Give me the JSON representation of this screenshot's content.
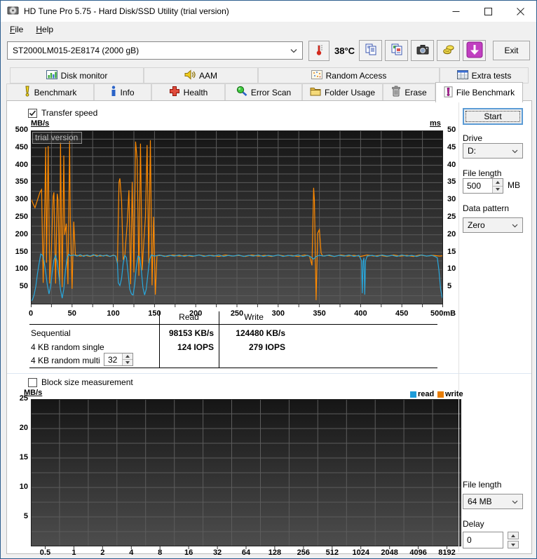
{
  "colors": {
    "read": "#29a8dd",
    "write": "#ff8a00",
    "legend_read": "#1d9cd9",
    "legend_write": "#e87d05",
    "grid": "#5c5c5c",
    "chart_top": "#151515",
    "chart_bottom": "#4d4d4d"
  },
  "window": {
    "title": "HD Tune Pro 5.75 - Hard Disk/SSD Utility (trial version)"
  },
  "menu": {
    "file": "File",
    "help": "Help"
  },
  "toolbar": {
    "drive_selected": "ST2000LM015-2E8174 (2000 gB)",
    "temperature": "38°C",
    "exit": "Exit"
  },
  "tabs": {
    "row1": [
      {
        "label": "Disk monitor"
      },
      {
        "label": "AAM"
      },
      {
        "label": "Random Access"
      },
      {
        "label": "Extra tests"
      }
    ],
    "row2": [
      {
        "label": "Benchmark"
      },
      {
        "label": "Info"
      },
      {
        "label": "Health"
      },
      {
        "label": "Error Scan"
      },
      {
        "label": "Folder Usage"
      },
      {
        "label": "Erase"
      },
      {
        "label": "File Benchmark"
      }
    ]
  },
  "bench": {
    "transfer_speed": "Transfer speed",
    "trial": "trial version",
    "block_size": "Block size measurement",
    "legend_read": "read",
    "legend_write": "write",
    "results": {
      "read_header": "Read",
      "write_header": "Write",
      "rows": [
        {
          "label": "Sequential",
          "read": "98153 KB/s",
          "write": "124480 KB/s"
        },
        {
          "label": "4 KB random single",
          "read": "124 IOPS",
          "write": "279 IOPS"
        },
        {
          "label": "4 KB random multi",
          "value": "32"
        }
      ]
    }
  },
  "panel": {
    "start": "Start",
    "drive_label": "Drive",
    "drive_value": "D:",
    "file_length_label": "File length",
    "file_length_value": "500",
    "file_length_unit": "MB",
    "data_pattern_label": "Data pattern",
    "data_pattern_value": "Zero",
    "file_length2_label": "File length",
    "file_length2_value": "64 MB",
    "delay_label": "Delay",
    "delay_value": "0"
  },
  "chart_data": [
    {
      "type": "line",
      "title": "Transfer speed",
      "ylabel_left": "MB/s",
      "ylabel_right": "ms",
      "x_range": [
        0,
        500
      ],
      "y_left_range": [
        0,
        500
      ],
      "y_right_range": [
        0,
        50
      ],
      "grid_step": 25,
      "x_ticks": [
        "0",
        "50",
        "100",
        "150",
        "200",
        "250",
        "300",
        "350",
        "400",
        "450",
        "500mB"
      ],
      "y_left_ticks": [
        500,
        450,
        400,
        350,
        300,
        250,
        200,
        150,
        100,
        50
      ],
      "y_right_ticks": [
        50,
        45,
        40,
        35,
        30,
        25,
        20,
        15,
        10,
        5
      ],
      "series": [
        {
          "name": "write",
          "color": "#ff8a00",
          "points": [
            [
              0,
              305
            ],
            [
              3,
              288
            ],
            [
              5,
              278
            ],
            [
              8,
              300
            ],
            [
              11,
              322
            ],
            [
              13,
              330
            ],
            [
              15,
              62
            ],
            [
              17,
              300
            ],
            [
              18,
              452
            ],
            [
              19,
              120
            ],
            [
              21,
              455
            ],
            [
              23,
              60
            ],
            [
              25,
              160
            ],
            [
              27,
              310
            ],
            [
              28,
              322
            ],
            [
              30,
              60
            ],
            [
              32,
              318
            ],
            [
              33,
              300
            ],
            [
              35,
              58
            ],
            [
              36,
              465
            ],
            [
              38,
              50
            ],
            [
              40,
              428
            ],
            [
              41,
              200
            ],
            [
              43,
              232
            ],
            [
              45,
              58
            ],
            [
              47,
              470
            ],
            [
              48,
              240
            ],
            [
              50,
              45
            ],
            [
              52,
              238
            ],
            [
              54,
              142
            ],
            [
              60,
              139
            ],
            [
              66,
              141
            ],
            [
              72,
              138
            ],
            [
              78,
              142
            ],
            [
              84,
              139
            ],
            [
              90,
              141
            ],
            [
              96,
              138
            ],
            [
              100,
              142
            ],
            [
              103,
              139
            ],
            [
              105,
              118
            ],
            [
              107,
              352
            ],
            [
              108,
              362
            ],
            [
              110,
              298
            ],
            [
              112,
              128
            ],
            [
              114,
              142
            ],
            [
              117,
              238
            ],
            [
              119,
              328
            ],
            [
              121,
              58
            ],
            [
              123,
              352
            ],
            [
              125,
              92
            ],
            [
              127,
              468
            ],
            [
              129,
              415
            ],
            [
              131,
              82
            ],
            [
              133,
              462
            ],
            [
              135,
              98
            ],
            [
              137,
              178
            ],
            [
              139,
              252
            ],
            [
              141,
              458
            ],
            [
              143,
              118
            ],
            [
              145,
              472
            ],
            [
              147,
              55
            ],
            [
              149,
              252
            ],
            [
              151,
              28
            ],
            [
              153,
              140
            ],
            [
              158,
              141
            ],
            [
              165,
              138
            ],
            [
              172,
              142
            ],
            [
              180,
              139
            ],
            [
              188,
              141
            ],
            [
              196,
              138
            ],
            [
              204,
              142
            ],
            [
              212,
              139
            ],
            [
              220,
              141
            ],
            [
              228,
              138
            ],
            [
              236,
              142
            ],
            [
              244,
              139
            ],
            [
              252,
              141
            ],
            [
              260,
              138
            ],
            [
              268,
              142
            ],
            [
              276,
              139
            ],
            [
              284,
              141
            ],
            [
              292,
              138
            ],
            [
              300,
              142
            ],
            [
              308,
              139
            ],
            [
              316,
              141
            ],
            [
              324,
              138
            ],
            [
              332,
              142
            ],
            [
              338,
              139
            ],
            [
              341,
              112
            ],
            [
              343,
              335
            ],
            [
              344,
              298
            ],
            [
              345,
              152
            ],
            [
              346,
              12
            ],
            [
              348,
              205
            ],
            [
              350,
              215
            ],
            [
              352,
              148
            ],
            [
              354,
              139
            ],
            [
              360,
              141
            ],
            [
              368,
              138
            ],
            [
              376,
              142
            ],
            [
              384,
              139
            ],
            [
              392,
              141
            ],
            [
              400,
              138
            ],
            [
              408,
              142
            ],
            [
              416,
              139
            ],
            [
              424,
              141
            ],
            [
              432,
              138
            ],
            [
              440,
              142
            ],
            [
              448,
              139
            ],
            [
              456,
              141
            ],
            [
              464,
              138
            ],
            [
              472,
              142
            ],
            [
              480,
              139
            ],
            [
              488,
              141
            ],
            [
              496,
              139
            ],
            [
              500,
              140
            ]
          ]
        },
        {
          "name": "read",
          "color": "#29a8dd",
          "points": [
            [
              0,
              8
            ],
            [
              2,
              14
            ],
            [
              4,
              28
            ],
            [
              6,
              52
            ],
            [
              8,
              88
            ],
            [
              10,
              118
            ],
            [
              12,
              145
            ],
            [
              14,
              141
            ],
            [
              16,
              126
            ],
            [
              18,
              92
            ],
            [
              20,
              56
            ],
            [
              22,
              30
            ],
            [
              24,
              52
            ],
            [
              26,
              94
            ],
            [
              28,
              128
            ],
            [
              30,
              141
            ],
            [
              32,
              122
            ],
            [
              34,
              82
            ],
            [
              36,
              42
            ],
            [
              38,
              18
            ],
            [
              40,
              44
            ],
            [
              42,
              98
            ],
            [
              44,
              134
            ],
            [
              46,
              144
            ],
            [
              48,
              140
            ],
            [
              52,
              142
            ],
            [
              56,
              139
            ],
            [
              60,
              143
            ],
            [
              64,
              138
            ],
            [
              68,
              142
            ],
            [
              72,
              139
            ],
            [
              76,
              143
            ],
            [
              80,
              138
            ],
            [
              84,
              142
            ],
            [
              88,
              139
            ],
            [
              92,
              142
            ],
            [
              96,
              138
            ],
            [
              100,
              141
            ],
            [
              103,
              139
            ],
            [
              105,
              118
            ],
            [
              106,
              62
            ],
            [
              108,
              54
            ],
            [
              110,
              74
            ],
            [
              112,
              118
            ],
            [
              114,
              141
            ],
            [
              116,
              134
            ],
            [
              118,
              88
            ],
            [
              120,
              44
            ],
            [
              122,
              30
            ],
            [
              124,
              27
            ],
            [
              126,
              58
            ],
            [
              128,
              108
            ],
            [
              130,
              139
            ],
            [
              132,
              136
            ],
            [
              134,
              98
            ],
            [
              136,
              48
            ],
            [
              138,
              27
            ],
            [
              140,
              44
            ],
            [
              142,
              88
            ],
            [
              144,
              128
            ],
            [
              146,
              142
            ],
            [
              150,
              139
            ],
            [
              156,
              142
            ],
            [
              162,
              138
            ],
            [
              168,
              141
            ],
            [
              174,
              139
            ],
            [
              180,
              142
            ],
            [
              186,
              138
            ],
            [
              192,
              141
            ],
            [
              198,
              139
            ],
            [
              204,
              142
            ],
            [
              210,
              138
            ],
            [
              216,
              141
            ],
            [
              222,
              139
            ],
            [
              228,
              142
            ],
            [
              234,
              138
            ],
            [
              240,
              141
            ],
            [
              246,
              139
            ],
            [
              252,
              142
            ],
            [
              258,
              138
            ],
            [
              264,
              141
            ],
            [
              270,
              139
            ],
            [
              276,
              142
            ],
            [
              282,
              138
            ],
            [
              288,
              141
            ],
            [
              294,
              139
            ],
            [
              300,
              142
            ],
            [
              306,
              138
            ],
            [
              312,
              141
            ],
            [
              318,
              139
            ],
            [
              324,
              142
            ],
            [
              330,
              138
            ],
            [
              336,
              141
            ],
            [
              340,
              136
            ],
            [
              343,
              130
            ],
            [
              346,
              138
            ],
            [
              350,
              141
            ],
            [
              356,
              139
            ],
            [
              362,
              142
            ],
            [
              368,
              138
            ],
            [
              374,
              141
            ],
            [
              380,
              139
            ],
            [
              386,
              142
            ],
            [
              392,
              138
            ],
            [
              398,
              141
            ],
            [
              401,
              126
            ],
            [
              402,
              32
            ],
            [
              403,
              122
            ],
            [
              404,
              134
            ],
            [
              405,
              28
            ],
            [
              406,
              126
            ],
            [
              408,
              139
            ],
            [
              414,
              141
            ],
            [
              420,
              138
            ],
            [
              426,
              142
            ],
            [
              432,
              139
            ],
            [
              438,
              141
            ],
            [
              444,
              138
            ],
            [
              450,
              142
            ],
            [
              456,
              139
            ],
            [
              462,
              141
            ],
            [
              468,
              138
            ],
            [
              474,
              142
            ],
            [
              480,
              139
            ],
            [
              486,
              141
            ],
            [
              490,
              138
            ],
            [
              493,
              134
            ],
            [
              495,
              98
            ],
            [
              497,
              44
            ],
            [
              499,
              20
            ],
            [
              500,
              16
            ]
          ]
        }
      ]
    },
    {
      "type": "line",
      "title": "Block size measurement",
      "ylabel": "MB/s",
      "y_range": [
        0,
        25
      ],
      "grid_step_y": 2.5,
      "y_ticks": [
        25,
        20,
        15,
        10,
        5
      ],
      "x_categories": [
        "0.5",
        "1",
        "2",
        "4",
        "8",
        "16",
        "32",
        "64",
        "128",
        "256",
        "512",
        "1024",
        "2048",
        "4096",
        "8192"
      ],
      "series": []
    }
  ]
}
